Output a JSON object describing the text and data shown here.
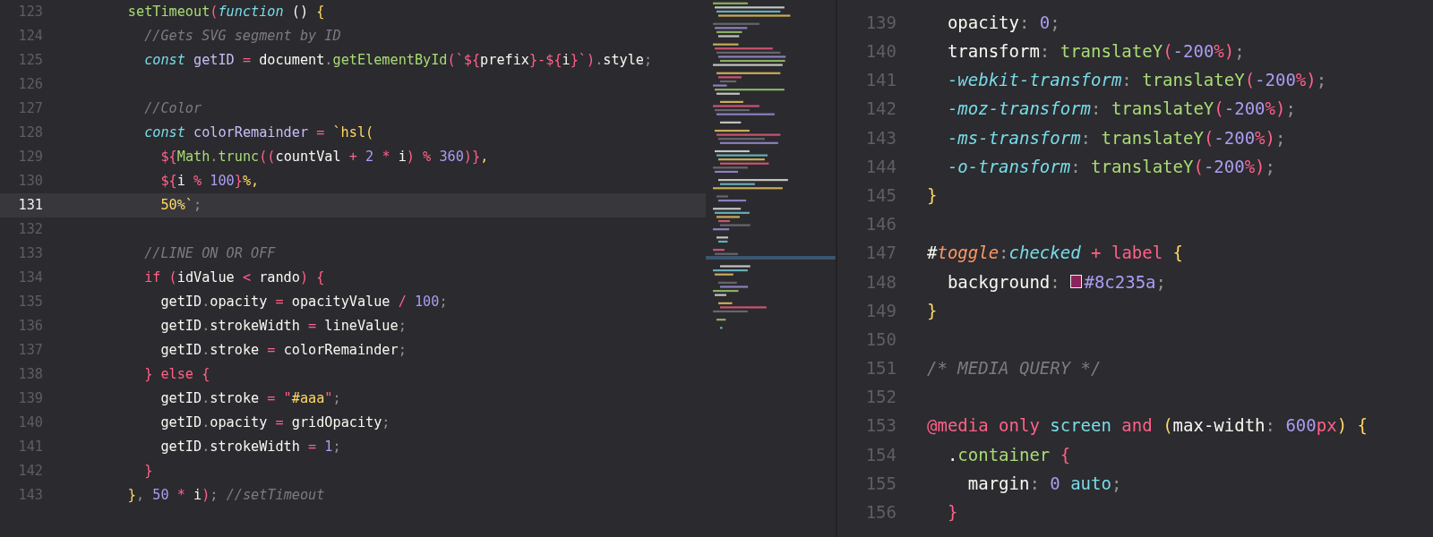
{
  "left_editor": {
    "lines": [
      {
        "number": "123",
        "current": false,
        "tokens": [
          {
            "kind": "func",
            "text": "      setTimeout"
          },
          {
            "kind": "op",
            "text": "("
          },
          {
            "kind": "storage",
            "text": "function"
          },
          {
            "kind": "plain",
            "text": " () "
          },
          {
            "kind": "str",
            "text": "{"
          }
        ]
      },
      {
        "number": "124",
        "current": false,
        "tokens": [
          {
            "kind": "comment",
            "text": "        //Gets SVG segment by ID"
          }
        ]
      },
      {
        "number": "125",
        "current": false,
        "tokens": [
          {
            "kind": "storage",
            "text": "        const"
          },
          {
            "kind": "decl",
            "text": " getID"
          },
          {
            "kind": "op",
            "text": " = "
          },
          {
            "kind": "plain",
            "text": "document"
          },
          {
            "kind": "punct",
            "text": "."
          },
          {
            "kind": "func",
            "text": "getElementById"
          },
          {
            "kind": "op",
            "text": "(`${"
          },
          {
            "kind": "plain",
            "text": "prefix"
          },
          {
            "kind": "op",
            "text": "}-${"
          },
          {
            "kind": "plain",
            "text": "i"
          },
          {
            "kind": "op",
            "text": "}`)"
          },
          {
            "kind": "punct",
            "text": "."
          },
          {
            "kind": "plain",
            "text": "style"
          },
          {
            "kind": "punct",
            "text": ";"
          }
        ]
      },
      {
        "number": "126",
        "current": false
      },
      {
        "number": "127",
        "current": false,
        "tokens": [
          {
            "kind": "comment",
            "text": "        //Color"
          }
        ]
      },
      {
        "number": "128",
        "current": false,
        "tokens": [
          {
            "kind": "storage",
            "text": "        const"
          },
          {
            "kind": "decl",
            "text": " colorRemainder"
          },
          {
            "kind": "op",
            "text": " = "
          },
          {
            "kind": "str",
            "text": "`hsl("
          }
        ]
      },
      {
        "number": "129",
        "current": false,
        "tokens": [
          {
            "kind": "op",
            "text": "          ${"
          },
          {
            "kind": "func",
            "text": "Math"
          },
          {
            "kind": "punct",
            "text": "."
          },
          {
            "kind": "func",
            "text": "trunc"
          },
          {
            "kind": "op",
            "text": "(("
          },
          {
            "kind": "plain",
            "text": "countVal"
          },
          {
            "kind": "op",
            "text": " + "
          },
          {
            "kind": "num",
            "text": "2"
          },
          {
            "kind": "op",
            "text": " * "
          },
          {
            "kind": "plain",
            "text": "i"
          },
          {
            "kind": "op",
            "text": ") % "
          },
          {
            "kind": "num",
            "text": "360"
          },
          {
            "kind": "op",
            "text": ")}"
          },
          {
            "kind": "str",
            "text": ","
          }
        ]
      },
      {
        "number": "130",
        "current": false,
        "tokens": [
          {
            "kind": "op",
            "text": "          ${"
          },
          {
            "kind": "plain",
            "text": "i"
          },
          {
            "kind": "op",
            "text": " % "
          },
          {
            "kind": "num",
            "text": "100"
          },
          {
            "kind": "op",
            "text": "}"
          },
          {
            "kind": "str",
            "text": "%,"
          }
        ]
      },
      {
        "number": "131",
        "current": true,
        "tokens": [
          {
            "kind": "str",
            "text": "          50%`"
          },
          {
            "kind": "punct",
            "text": ";"
          }
        ]
      },
      {
        "number": "132",
        "current": false
      },
      {
        "number": "133",
        "current": false,
        "tokens": [
          {
            "kind": "comment",
            "text": "        //LINE ON OR OFF"
          }
        ]
      },
      {
        "number": "134",
        "current": false,
        "tokens": [
          {
            "kind": "op",
            "text": "        if ("
          },
          {
            "kind": "plain",
            "text": "idValue"
          },
          {
            "kind": "op",
            "text": " < "
          },
          {
            "kind": "plain",
            "text": "rando"
          },
          {
            "kind": "op",
            "text": ") {"
          }
        ]
      },
      {
        "number": "135",
        "current": false,
        "tokens": [
          {
            "kind": "plain",
            "text": "          getID"
          },
          {
            "kind": "punct",
            "text": "."
          },
          {
            "kind": "plain",
            "text": "opacity"
          },
          {
            "kind": "op",
            "text": " = "
          },
          {
            "kind": "plain",
            "text": "opacityValue"
          },
          {
            "kind": "op",
            "text": " / "
          },
          {
            "kind": "num",
            "text": "100"
          },
          {
            "kind": "punct",
            "text": ";"
          }
        ]
      },
      {
        "number": "136",
        "current": false,
        "tokens": [
          {
            "kind": "plain",
            "text": "          getID"
          },
          {
            "kind": "punct",
            "text": "."
          },
          {
            "kind": "plain",
            "text": "strokeWidth"
          },
          {
            "kind": "op",
            "text": " = "
          },
          {
            "kind": "plain",
            "text": "lineValue"
          },
          {
            "kind": "punct",
            "text": ";"
          }
        ]
      },
      {
        "number": "137",
        "current": false,
        "tokens": [
          {
            "kind": "plain",
            "text": "          getID"
          },
          {
            "kind": "punct",
            "text": "."
          },
          {
            "kind": "plain",
            "text": "stroke"
          },
          {
            "kind": "op",
            "text": " = "
          },
          {
            "kind": "plain",
            "text": "colorRemainder"
          },
          {
            "kind": "punct",
            "text": ";"
          }
        ]
      },
      {
        "number": "138",
        "current": false,
        "tokens": [
          {
            "kind": "op",
            "text": "        } else {"
          }
        ]
      },
      {
        "number": "139",
        "current": false,
        "tokens": [
          {
            "kind": "plain",
            "text": "          getID"
          },
          {
            "kind": "punct",
            "text": "."
          },
          {
            "kind": "plain",
            "text": "stroke"
          },
          {
            "kind": "op",
            "text": " = \""
          },
          {
            "kind": "str",
            "text": "#aaa"
          },
          {
            "kind": "op",
            "text": "\""
          },
          {
            "kind": "punct",
            "text": ";"
          }
        ]
      },
      {
        "number": "140",
        "current": false,
        "tokens": [
          {
            "kind": "plain",
            "text": "          getID"
          },
          {
            "kind": "punct",
            "text": "."
          },
          {
            "kind": "plain",
            "text": "opacity"
          },
          {
            "kind": "op",
            "text": " = "
          },
          {
            "kind": "plain",
            "text": "gridOpacity"
          },
          {
            "kind": "punct",
            "text": ";"
          }
        ]
      },
      {
        "number": "141",
        "current": false,
        "tokens": [
          {
            "kind": "plain",
            "text": "          getID"
          },
          {
            "kind": "punct",
            "text": "."
          },
          {
            "kind": "plain",
            "text": "strokeWidth"
          },
          {
            "kind": "op",
            "text": " = "
          },
          {
            "kind": "num",
            "text": "1"
          },
          {
            "kind": "punct",
            "text": ";"
          }
        ]
      },
      {
        "number": "142",
        "current": false,
        "tokens": [
          {
            "kind": "op",
            "text": "        }"
          }
        ]
      },
      {
        "number": "143",
        "current": false,
        "tokens": [
          {
            "kind": "str",
            "text": "      }"
          },
          {
            "kind": "punct",
            "text": ","
          },
          {
            "kind": "num",
            "text": " 50"
          },
          {
            "kind": "op",
            "text": " * "
          },
          {
            "kind": "plain",
            "text": "i"
          },
          {
            "kind": "op",
            "text": ")"
          },
          {
            "kind": "punct",
            "text": ";"
          },
          {
            "kind": "comment",
            "text": " //setTimeout"
          }
        ]
      }
    ]
  },
  "right_editor": {
    "lines": [
      {
        "number": "139",
        "tokens": [
          {
            "kind": "plain",
            "text": "  opacity"
          },
          {
            "kind": "punct",
            "text": ":"
          },
          {
            "kind": "num",
            "text": " 0"
          },
          {
            "kind": "punct",
            "text": ";"
          }
        ]
      },
      {
        "number": "140",
        "tokens": [
          {
            "kind": "plain",
            "text": "  transform"
          },
          {
            "kind": "punct",
            "text": ":"
          },
          {
            "kind": "func",
            "text": " translateY"
          },
          {
            "kind": "op",
            "text": "("
          },
          {
            "kind": "num",
            "text": "-200"
          },
          {
            "kind": "op",
            "text": "%)"
          },
          {
            "kind": "punct",
            "text": ";"
          }
        ]
      },
      {
        "number": "141",
        "tokens": [
          {
            "kind": "prop",
            "text": "  -webkit-transform"
          },
          {
            "kind": "punct",
            "text": ":"
          },
          {
            "kind": "func",
            "text": " translateY"
          },
          {
            "kind": "op",
            "text": "("
          },
          {
            "kind": "num",
            "text": "-200"
          },
          {
            "kind": "op",
            "text": "%)"
          },
          {
            "kind": "punct",
            "text": ";"
          }
        ]
      },
      {
        "number": "142",
        "tokens": [
          {
            "kind": "prop",
            "text": "  -moz-transform"
          },
          {
            "kind": "punct",
            "text": ":"
          },
          {
            "kind": "func",
            "text": " translateY"
          },
          {
            "kind": "op",
            "text": "("
          },
          {
            "kind": "num",
            "text": "-200"
          },
          {
            "kind": "op",
            "text": "%)"
          },
          {
            "kind": "punct",
            "text": ";"
          }
        ]
      },
      {
        "number": "143",
        "tokens": [
          {
            "kind": "prop",
            "text": "  -ms-transform"
          },
          {
            "kind": "punct",
            "text": ":"
          },
          {
            "kind": "func",
            "text": " translateY"
          },
          {
            "kind": "op",
            "text": "("
          },
          {
            "kind": "num",
            "text": "-200"
          },
          {
            "kind": "op",
            "text": "%)"
          },
          {
            "kind": "punct",
            "text": ";"
          }
        ]
      },
      {
        "number": "144",
        "tokens": [
          {
            "kind": "prop",
            "text": "  -o-transform"
          },
          {
            "kind": "punct",
            "text": ":"
          },
          {
            "kind": "func",
            "text": " translateY"
          },
          {
            "kind": "op",
            "text": "("
          },
          {
            "kind": "num",
            "text": "-200"
          },
          {
            "kind": "op",
            "text": "%)"
          },
          {
            "kind": "punct",
            "text": ";"
          }
        ]
      },
      {
        "number": "145",
        "tokens": [
          {
            "kind": "str",
            "text": "}"
          }
        ]
      },
      {
        "number": "146"
      },
      {
        "number": "147",
        "tokens": [
          {
            "kind": "plain",
            "text": "#"
          },
          {
            "kind": "orange",
            "text": "toggle"
          },
          {
            "kind": "punct",
            "text": ":"
          },
          {
            "kind": "prop",
            "text": "checked"
          },
          {
            "kind": "op",
            "text": " + label "
          },
          {
            "kind": "str",
            "text": "{"
          }
        ]
      },
      {
        "number": "148",
        "tokens": [
          {
            "kind": "plain",
            "text": "  background"
          },
          {
            "kind": "punct",
            "text": ": "
          },
          {
            "kind": "swatch",
            "color": "#8c235a"
          },
          {
            "kind": "num",
            "text": "#8c235a"
          },
          {
            "kind": "punct",
            "text": ";"
          }
        ]
      },
      {
        "number": "149",
        "tokens": [
          {
            "kind": "str",
            "text": "}"
          }
        ]
      },
      {
        "number": "150"
      },
      {
        "number": "151",
        "tokens": [
          {
            "kind": "comment",
            "text": "/* MEDIA QUERY */"
          }
        ]
      },
      {
        "number": "152"
      },
      {
        "number": "153",
        "tokens": [
          {
            "kind": "op",
            "text": "@media only "
          },
          {
            "kind": "type",
            "text": "screen"
          },
          {
            "kind": "op",
            "text": " and "
          },
          {
            "kind": "str",
            "text": "("
          },
          {
            "kind": "plain",
            "text": "max-width"
          },
          {
            "kind": "punct",
            "text": ": "
          },
          {
            "kind": "num",
            "text": "600"
          },
          {
            "kind": "op",
            "text": "px"
          },
          {
            "kind": "str",
            "text": ") {"
          }
        ]
      },
      {
        "number": "154",
        "tokens": [
          {
            "kind": "plain",
            "text": "  ."
          },
          {
            "kind": "func",
            "text": "container"
          },
          {
            "kind": "op",
            "text": " {"
          }
        ]
      },
      {
        "number": "155",
        "tokens": [
          {
            "kind": "plain",
            "text": "    margin"
          },
          {
            "kind": "punct",
            "text": ":"
          },
          {
            "kind": "num",
            "text": " 0"
          },
          {
            "kind": "type",
            "text": " auto"
          },
          {
            "kind": "punct",
            "text": ";"
          }
        ]
      },
      {
        "number": "156",
        "tokens": [
          {
            "kind": "op",
            "text": "  }"
          }
        ]
      }
    ]
  }
}
